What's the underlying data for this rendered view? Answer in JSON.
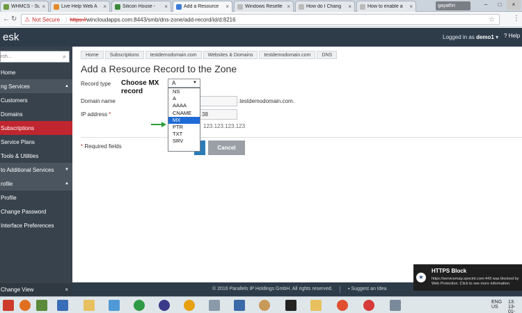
{
  "browser": {
    "tabs": [
      {
        "label": "WHMCS - Supp",
        "color": "#6c9a3b"
      },
      {
        "label": "Live Help Web A",
        "color": "#e58a2a"
      },
      {
        "label": "Silicon House - ",
        "color": "#3a8a3a"
      },
      {
        "label": "Add a Resource",
        "color": "#3b7dd8"
      },
      {
        "label": "Windows Reselle",
        "color": "#bbbbbb"
      },
      {
        "label": "How do I Chang",
        "color": "#bbbbbb"
      },
      {
        "label": "How to enable a",
        "color": "#bbbbbb"
      }
    ],
    "active_tab": 3,
    "user_chip": "gayathri",
    "not_secure_label": "Not Secure",
    "url_scheme": "https://",
    "url_rest": "wincloudapps.com:8443/smb/dns-zone/add-record/id/d:8216"
  },
  "header": {
    "logo": "esk",
    "logged_in_label": "Logged in as",
    "username": "demo1",
    "help_label": "Help"
  },
  "sidebar": {
    "search_placeholder": "rch...",
    "items": [
      {
        "label": "Home",
        "type": "item"
      },
      {
        "label": "ng Services",
        "type": "group"
      },
      {
        "label": "Customers",
        "type": "item"
      },
      {
        "label": "Domains",
        "type": "item"
      },
      {
        "label": "Subscriptions",
        "type": "item",
        "selected": true
      },
      {
        "label": "Service Plans",
        "type": "item"
      },
      {
        "label": "Tools & Utilities",
        "type": "item"
      },
      {
        "label": "to Additional Services",
        "type": "group"
      },
      {
        "label": "rofile",
        "type": "group"
      },
      {
        "label": "Profile",
        "type": "item"
      },
      {
        "label": "Change Password",
        "type": "item"
      },
      {
        "label": "Interface Preferences",
        "type": "item"
      }
    ],
    "change_view": "Change View"
  },
  "main": {
    "breadcrumbs": [
      "Home",
      "Subscriptions",
      "testdemodomain.com",
      "Websites & Domains",
      "testdemodomain.com",
      "DNS"
    ],
    "title": "Add a Resource Record to the Zone",
    "record_type_label": "Record type",
    "annotation": "Choose MX record",
    "selected_type": "A",
    "options": [
      "NS",
      "A",
      "AAAA",
      "CNAME",
      "MX",
      "PTR",
      "TXT",
      "SRV"
    ],
    "highlighted_option": 4,
    "domain_name_label": "Domain name",
    "domain_suffix": ".testdemodomain.com.",
    "ip_label": "IP address",
    "ip_value": "38",
    "ip_hint": "123.123.123.123",
    "required_note": "Required fields",
    "cancel_label": "Cancel"
  },
  "footer": {
    "copyright": "© 2016 Parallels IP Holdings GmbH. All rights reserved.",
    "suggest": "Suggest an Idea"
  },
  "notification": {
    "title": "HTTPS Block",
    "text": "https://servicemap.spocint.com:443 was blocked by Web Protection. Click to see more information."
  },
  "taskbar": {
    "lang_top": "ENG",
    "lang_bottom": "US",
    "time": "13:",
    "date": "13-01-"
  },
  "colors": {
    "header_bg": "#2e3c4a",
    "sidebar_bg": "#38424c",
    "selected_nav": "#c0262f",
    "highlight": "#1e6ad6"
  }
}
